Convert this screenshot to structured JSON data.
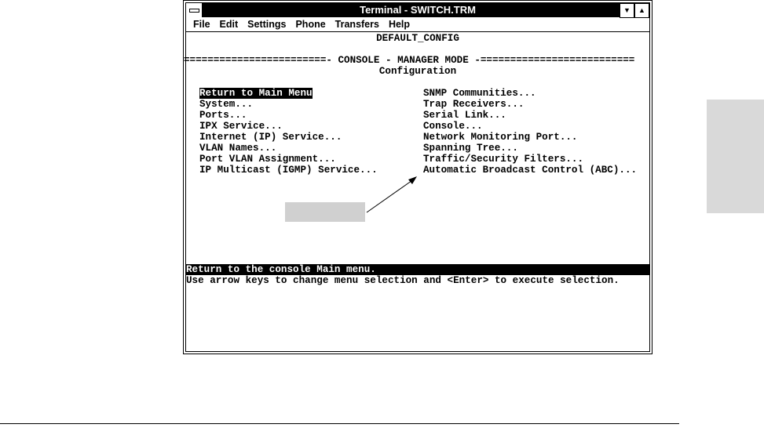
{
  "window": {
    "title": "Terminal - SWITCH.TRM"
  },
  "menu": [
    "File",
    "Edit",
    "Settings",
    "Phone",
    "Transfers",
    "Help"
  ],
  "terminal": {
    "config_name": "DEFAULT_CONFIG",
    "mode_line": "========================- CONSOLE - MANAGER MODE -==========================",
    "screen_title": "Configuration",
    "left_items": [
      "Return to Main Menu",
      "System...",
      "Ports...",
      "IPX Service...",
      "Internet (IP) Service...",
      "VLAN Names...",
      "Port VLAN Assignment...",
      "IP Multicast (IGMP) Service..."
    ],
    "right_items": [
      "SNMP Communities...",
      "Trap Receivers...",
      "Serial Link...",
      "Console...",
      "Network Monitoring Port...",
      "Spanning Tree...",
      "Traffic/Security Filters...",
      "Automatic Broadcast Control (ABC)..."
    ],
    "status": "Return to the console Main menu.",
    "help": "Use arrow keys to change menu selection and <Enter> to execute selection."
  }
}
